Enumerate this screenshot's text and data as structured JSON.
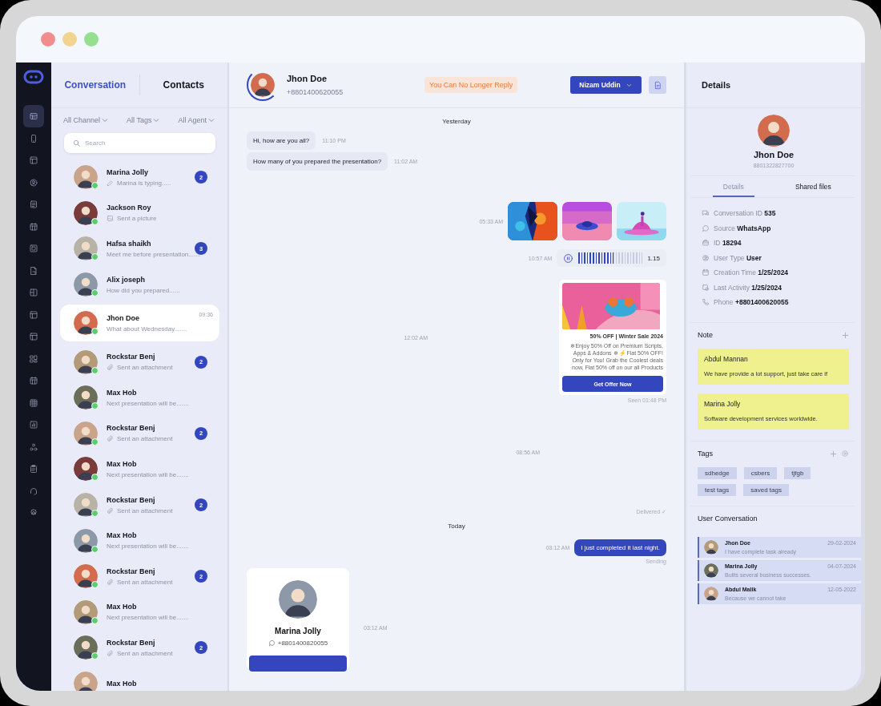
{
  "sidebar_nav": [
    {
      "selected": true
    },
    {
      "selected": false
    },
    {
      "selected": false
    },
    {
      "selected": false
    },
    {
      "selected": false
    },
    {
      "selected": false
    },
    {
      "selected": false
    },
    {
      "selected": false
    },
    {
      "selected": false
    },
    {
      "selected": false
    },
    {
      "selected": false
    },
    {
      "selected": false
    },
    {
      "selected": false
    },
    {
      "selected": false
    },
    {
      "selected": false
    },
    {
      "selected": false
    },
    {
      "selected": false
    },
    {
      "selected": false
    },
    {
      "selected": false
    }
  ],
  "list_panel": {
    "tabs": [
      {
        "label": "Conversation",
        "selected": true
      },
      {
        "label": "Contacts",
        "selected": false
      }
    ],
    "filters": [
      "All Channel",
      "All Tags",
      "All Agent"
    ],
    "search": {
      "placeholder": "Search"
    },
    "conversations": [
      {
        "name": "Marina Jolly",
        "kind": "typing",
        "preview": "Marina is typing.....",
        "unread": "2",
        "selected": false,
        "online": true
      },
      {
        "name": "Jackson Roy",
        "kind": "picture",
        "preview": "Sent a picture",
        "selected": false,
        "online": true
      },
      {
        "name": "Hafsa shaikh",
        "kind": "text",
        "preview": "Meet me before presentation.......",
        "unread": "3",
        "selected": false,
        "online": true
      },
      {
        "name": "Alix joseph",
        "kind": "text",
        "preview": "How did you prepared......",
        "selected": false,
        "online": true
      },
      {
        "name": "Jhon Doe",
        "kind": "text",
        "preview": "What about Wednesday.......",
        "time": "09:36",
        "selected": true,
        "online": true
      },
      {
        "name": "Rockstar Benj",
        "kind": "attachment",
        "preview": "Sent an attachment",
        "unread": "2",
        "selected": false,
        "online": true
      },
      {
        "name": "Max Hob",
        "kind": "text",
        "preview": "Next presentation will be.......",
        "selected": false,
        "online": true
      },
      {
        "name": "Rockstar Benj",
        "kind": "attachment",
        "preview": "Sent an attachment",
        "unread": "2",
        "selected": false,
        "online": true
      },
      {
        "name": "Max Hob",
        "kind": "text",
        "preview": "Next presentation will be.......",
        "selected": false,
        "online": true
      },
      {
        "name": "Rockstar Benj",
        "kind": "attachment",
        "preview": "Sent an attachment",
        "unread": "2",
        "selected": false,
        "online": true
      },
      {
        "name": "Max Hob",
        "kind": "text",
        "preview": "Next presentation will be.......",
        "selected": false,
        "online": true
      },
      {
        "name": "Rockstar Benj",
        "kind": "attachment",
        "preview": "Sent an attachment",
        "unread": "2",
        "selected": false,
        "online": true
      },
      {
        "name": "Max Hob",
        "kind": "text",
        "preview": "Next presentation will be.......",
        "selected": false,
        "online": true
      },
      {
        "name": "Rockstar Benj",
        "kind": "attachment",
        "preview": "Sent an attachment",
        "unread": "2",
        "selected": false,
        "online": true
      },
      {
        "name": "Max Hob",
        "selected": false,
        "online": false
      }
    ]
  },
  "chat": {
    "contact": {
      "name": "Jhon Doe",
      "phone": "+8801400620055"
    },
    "notice": "You Can No Longer Reply",
    "agent_button": "Nizam Uddin",
    "messages": [
      {
        "kind": "divider",
        "text": "Yesterday"
      },
      {
        "kind": "incoming",
        "text": "Hi, how are you all?",
        "time": "11:10 PM"
      },
      {
        "kind": "incoming",
        "text": "How many of you prepared the presentation?",
        "time": "11:02 AM"
      },
      {
        "kind": "gallery",
        "time": "05:33 AM"
      },
      {
        "kind": "audio",
        "time": "10:57 AM",
        "level": 0.55,
        "duration": "1.15"
      },
      {
        "kind": "promo",
        "time": "12:02 AM",
        "title": "50% OFF | Winter Sale 2024",
        "body": "❄Enjoy 50% Off on Premium Scripts, Apps & Addons ❄ ⚡Flat 50% OFF! Only for You! Grab the Coolest deals now, Flat 50% off on our all Products",
        "button": "Get Offer Now",
        "status": "Seen 01:48 PM"
      },
      {
        "kind": "timestamp",
        "time": "08:56 AM"
      },
      {
        "kind": "status",
        "text": "Delivered ✓"
      },
      {
        "kind": "divider",
        "text": "Today"
      },
      {
        "kind": "outgoing",
        "text": "I just completed it last night.",
        "time": "03:12 AM",
        "status": "Sending"
      },
      {
        "kind": "contact_card",
        "name": "Marina Jolly",
        "phone": "+8801400820055",
        "time": "03:12 AM"
      }
    ]
  },
  "details": {
    "title": "Details",
    "name": "Jhon Doe",
    "phone": "8801322827700",
    "tabs": [
      {
        "label": "Details",
        "selected": true
      },
      {
        "label": "Shared files",
        "selected": false
      }
    ],
    "fields": [
      {
        "kind": "chat",
        "text": "Conversation ID **535**"
      },
      {
        "kind": "whatsapp",
        "text": "Source **WhatsApp**"
      },
      {
        "kind": "id",
        "text": "ID **18294**"
      },
      {
        "kind": "user",
        "text": "User Type **User**"
      },
      {
        "kind": "calendar",
        "text": "Creation Time **1/25/2024**"
      },
      {
        "kind": "activity",
        "text": "Last Activity **1/25/2024**"
      },
      {
        "kind": "phone",
        "text": "Phone **+8801400620055**"
      }
    ],
    "notes": {
      "title": "Note",
      "items": [
        {
          "author": "Abdul Mannan",
          "text": "We have provide a lot support, just take care if"
        },
        {
          "author": "Marina Jolly",
          "text": "Software development services worldwide."
        }
      ]
    },
    "tags": {
      "title": "Tags",
      "items": [
        "sdhedge",
        "csbers",
        "tjfgb",
        "test tags",
        "saved tags"
      ]
    },
    "user_conversation": {
      "title": "User Conversation",
      "items": [
        {
          "name": "Jhon Doe",
          "date": "29-02-2024",
          "text": "I have complete task already"
        },
        {
          "name": "Marina Jolly",
          "date": "04-07-2024",
          "text": "Builts several business successes."
        },
        {
          "name": "Abdul Malik",
          "date": "12-05-2022",
          "text": "Because we cannot take"
        }
      ]
    }
  }
}
